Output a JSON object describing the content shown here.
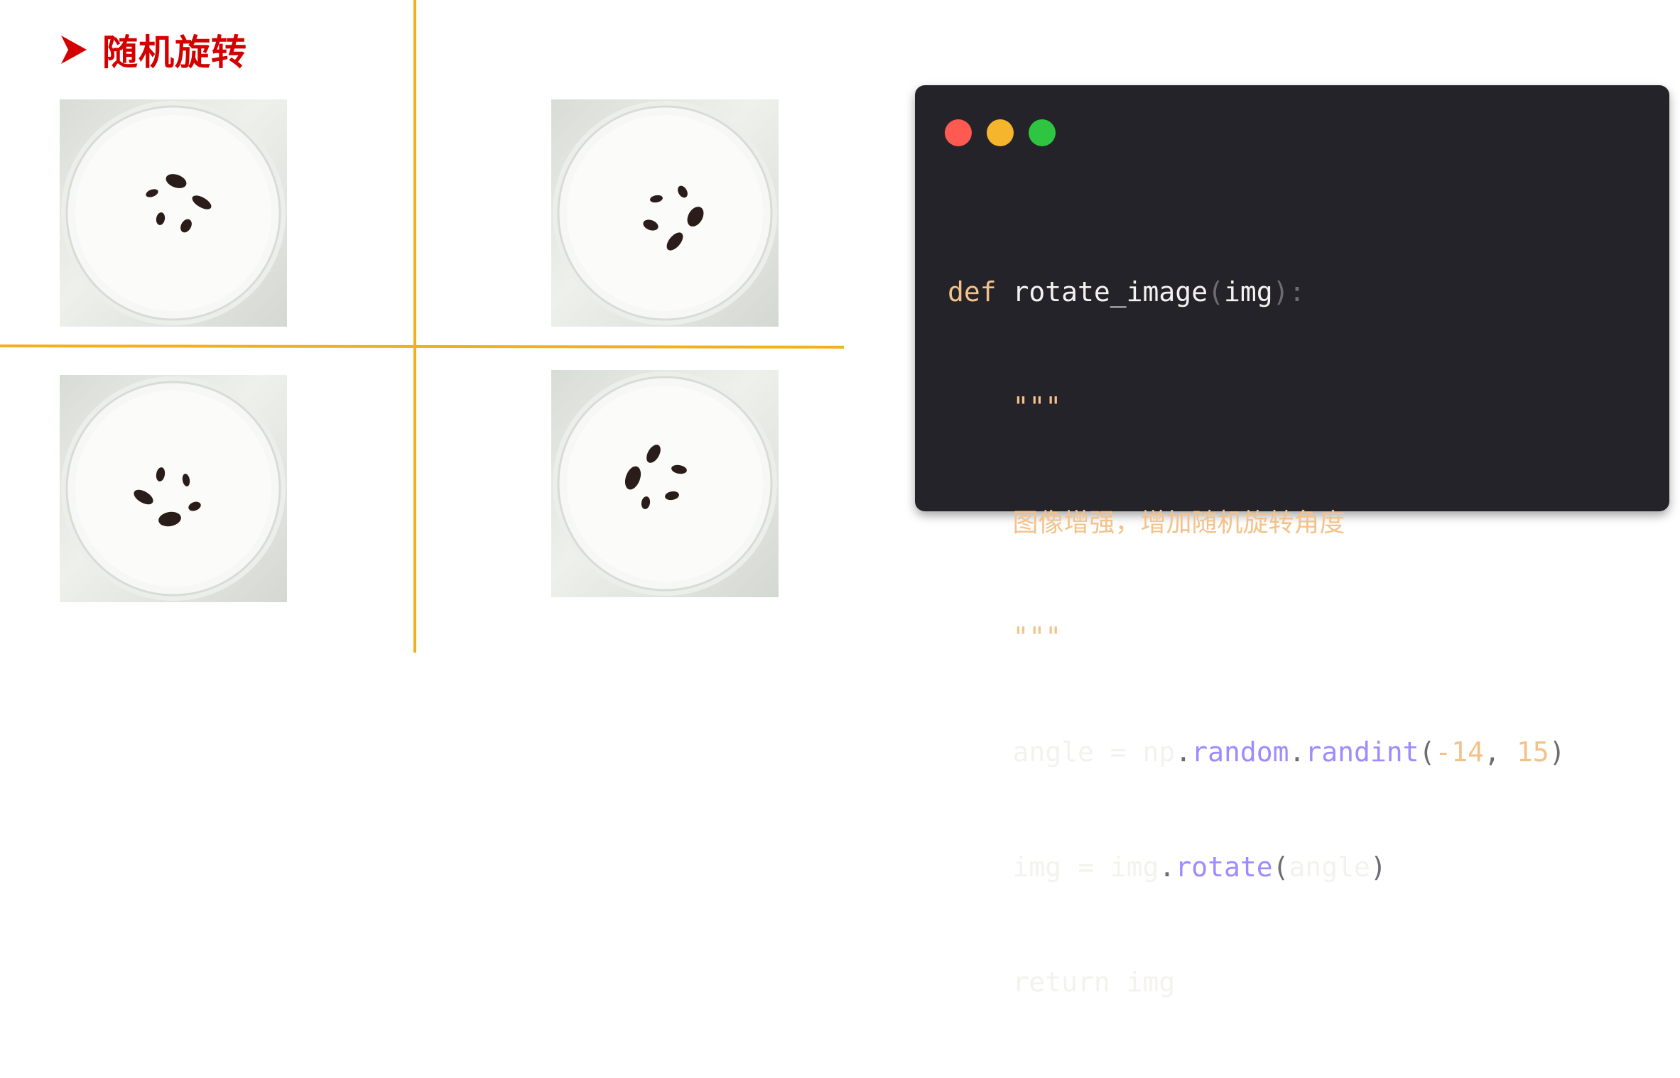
{
  "slide": {
    "title": "随机旋转",
    "accent_color": "#d40000",
    "divider_color": "#f2b01e"
  },
  "images": [
    {
      "name": "petri-dish-insects-original",
      "icon": "image"
    },
    {
      "name": "petri-dish-insects-rotated-1",
      "icon": "image"
    },
    {
      "name": "petri-dish-insects-rotated-2",
      "icon": "image"
    },
    {
      "name": "petri-dish-insects-rotated-3",
      "icon": "image"
    }
  ],
  "code_window": {
    "background": "#25232a",
    "traffic_lights": [
      "#ff5a52",
      "#f5b52c",
      "#2ec641"
    ],
    "lines": {
      "l1_kw": "def",
      "l1_name": "rotate_image",
      "l1_open": "(",
      "l1_arg": "img",
      "l1_close": "):",
      "l2_doc": "\"\"\"",
      "l3_doc": "图像增强，增加随机旋转角度",
      "l4_doc": "\"\"\"",
      "l5_var": "angle",
      "l5_eq": " = ",
      "l5_np": "np",
      "l5_dot1": ".",
      "l5_random": "random",
      "l5_dot2": ".",
      "l5_randint": "randint",
      "l5_open": "(",
      "l5_a": "-14",
      "l5_comma": ", ",
      "l5_b": "15",
      "l5_close": ")",
      "l6_var": "img",
      "l6_eq": " = ",
      "l6_obj": "img",
      "l6_dot": ".",
      "l6_rotate": "rotate",
      "l6_open": "(",
      "l6_arg": "angle",
      "l6_close": ")",
      "l7_kw": "return",
      "l7_val": " img"
    }
  }
}
